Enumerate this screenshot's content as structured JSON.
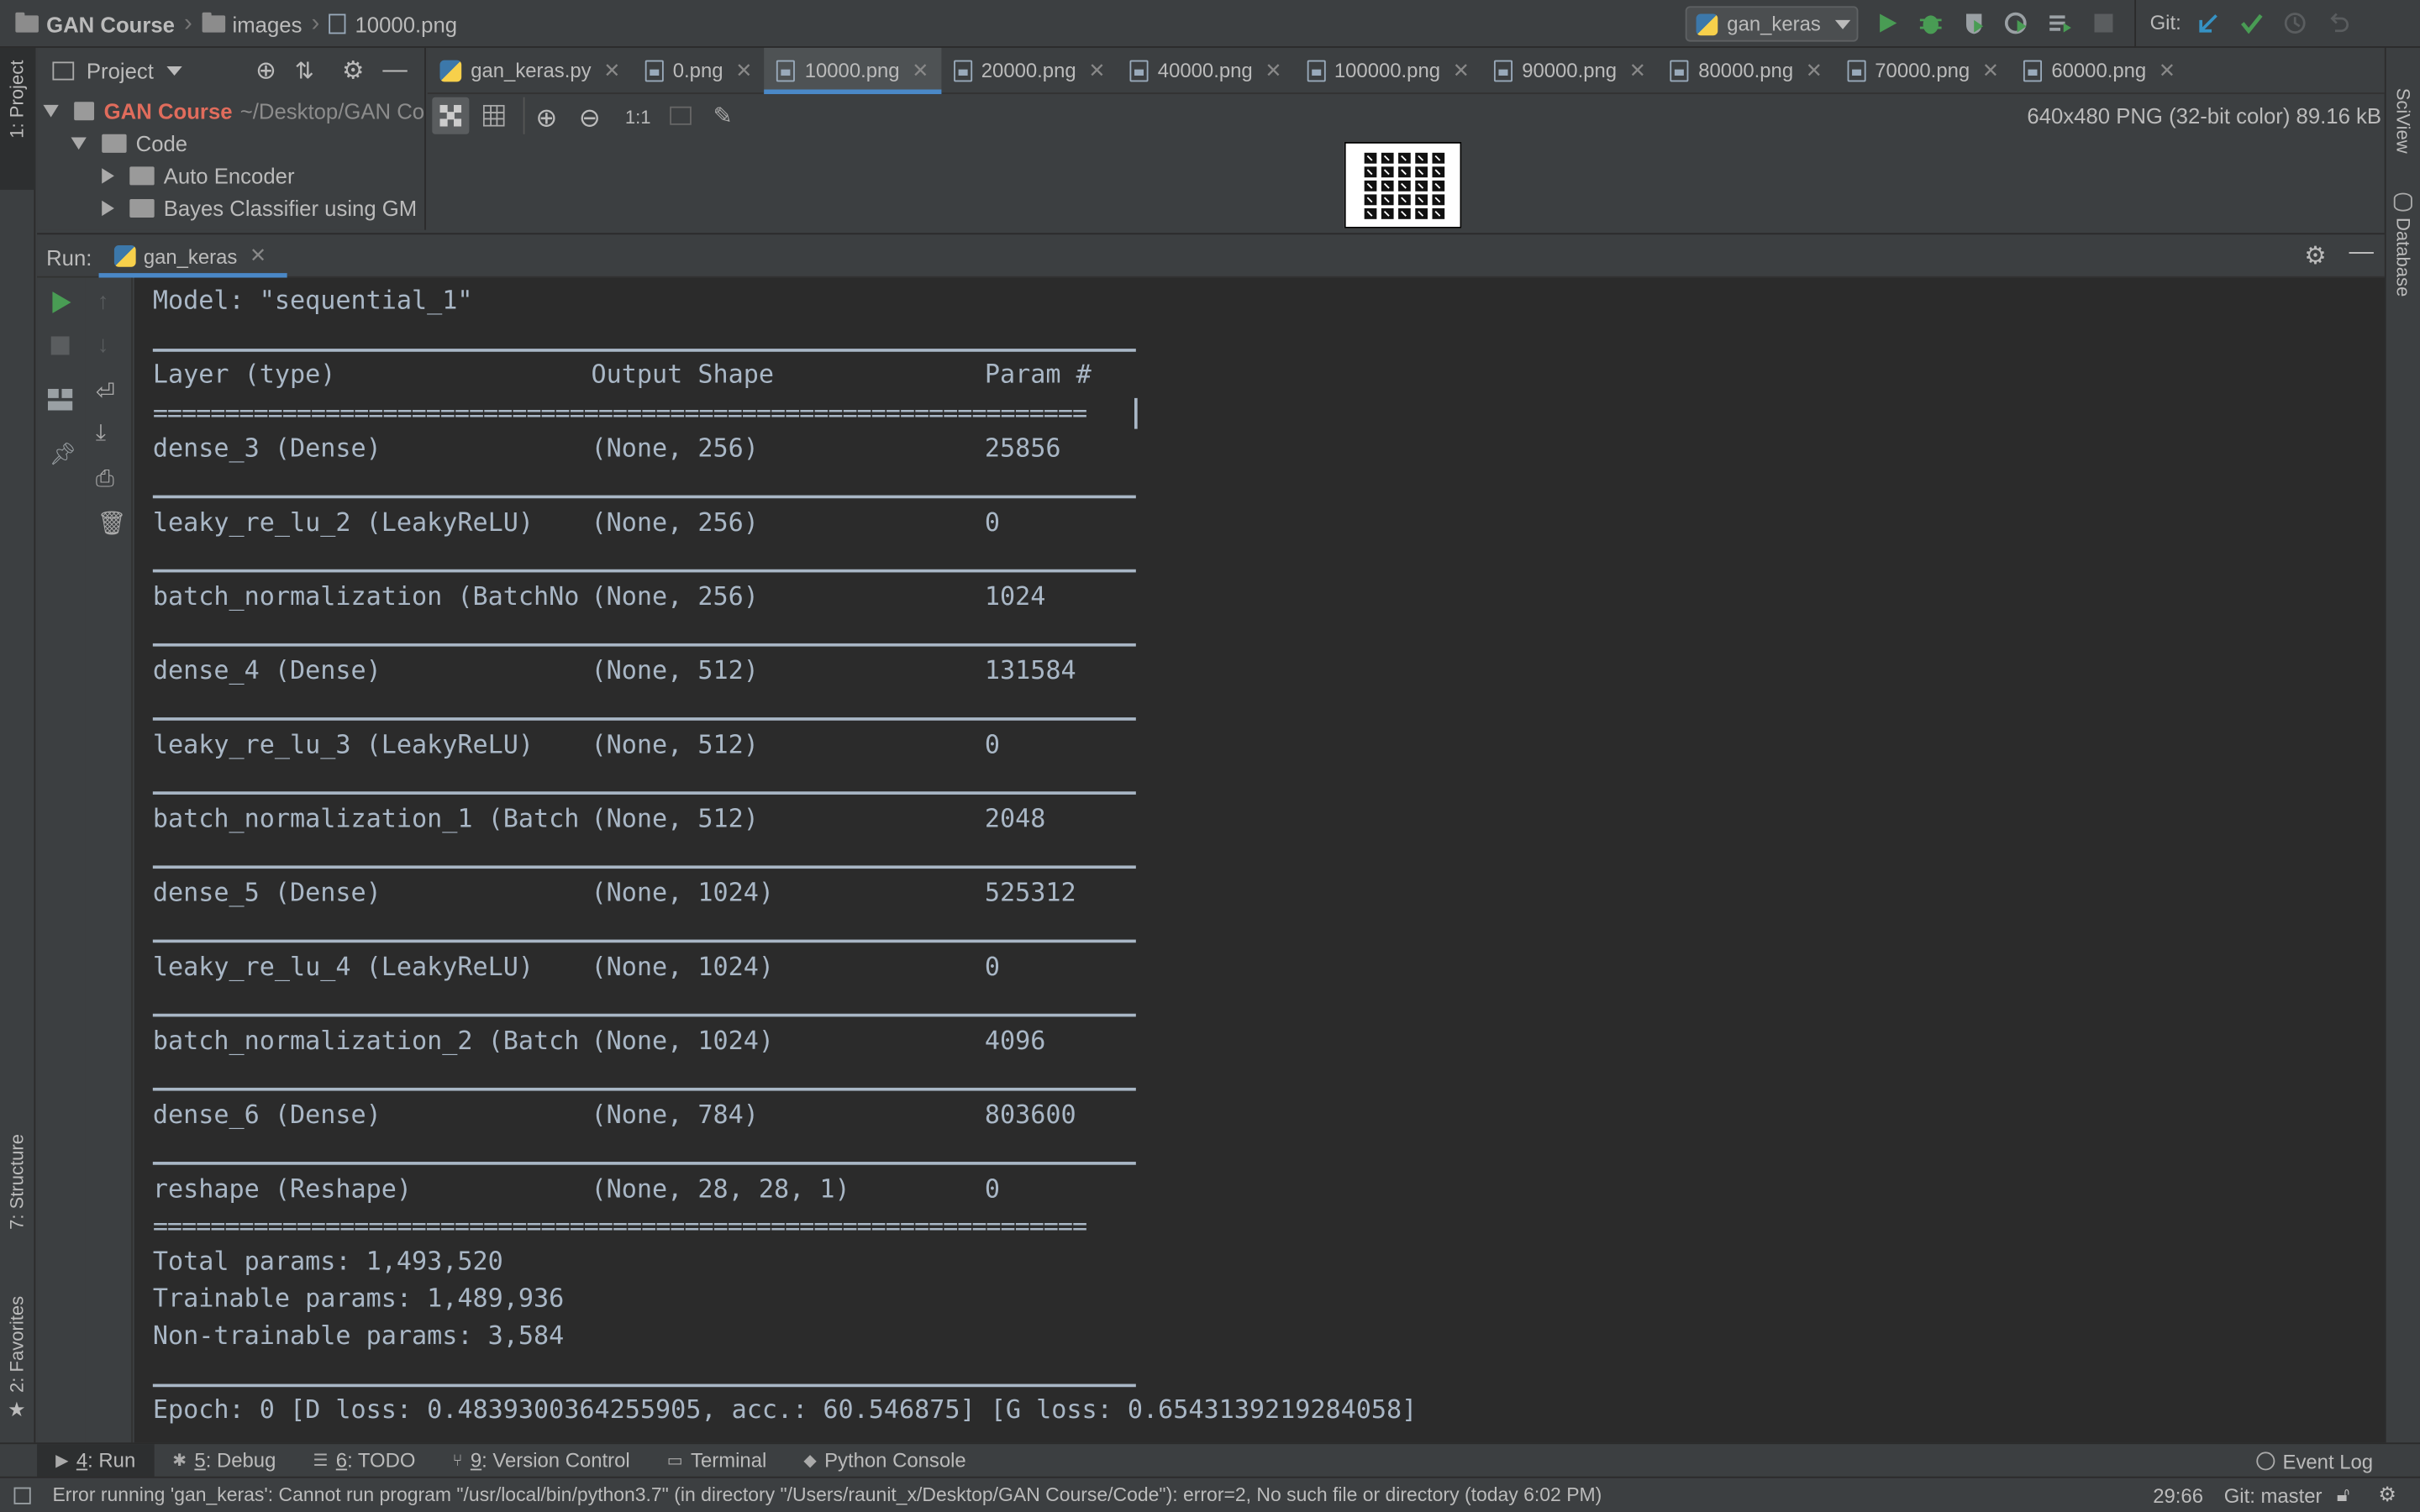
{
  "breadcrumb": {
    "project": "GAN Course",
    "folder": "images",
    "file": "10000.png"
  },
  "toolbar": {
    "run_config": "gan_keras",
    "git_label": "Git:"
  },
  "project_panel": {
    "title": "Project",
    "tree": [
      {
        "label": "GAN Course",
        "suffix": "~/Desktop/GAN Co",
        "expanded": true
      },
      {
        "label": "Code",
        "expanded": true
      },
      {
        "label": "Auto Encoder",
        "expanded": false
      },
      {
        "label": "Bayes Classifier using GM",
        "expanded": false
      }
    ]
  },
  "tabs": [
    {
      "label": "gan_keras.py",
      "active": false
    },
    {
      "label": "0.png",
      "active": false
    },
    {
      "label": "10000.png",
      "active": true
    },
    {
      "label": "20000.png",
      "active": false
    },
    {
      "label": "40000.png",
      "active": false
    },
    {
      "label": "100000.png",
      "active": false
    },
    {
      "label": "90000.png",
      "active": false
    },
    {
      "label": "80000.png",
      "active": false
    },
    {
      "label": "70000.png",
      "active": false
    },
    {
      "label": "60000.png",
      "active": false
    }
  ],
  "image_viewer": {
    "zoom_label": "1:1",
    "info": "640x480 PNG (32-bit color) 89.16 kB"
  },
  "run_panel": {
    "label": "Run:",
    "tab": "gan_keras"
  },
  "console": {
    "model_line": "Model: \"sequential_1\"",
    "headers": {
      "layer": "Layer (type)",
      "shape": "Output Shape",
      "params": "Param #"
    },
    "double_rule": "=================================================================",
    "layers": [
      {
        "layer": "dense_3 (Dense)",
        "shape": "(None, 256)",
        "params": "25856"
      },
      {
        "layer": "leaky_re_lu_2 (LeakyReLU)",
        "shape": "(None, 256)",
        "params": "0"
      },
      {
        "layer": "batch_normalization (BatchNo",
        "shape": "(None, 256)",
        "params": "1024"
      },
      {
        "layer": "dense_4 (Dense)",
        "shape": "(None, 512)",
        "params": "131584"
      },
      {
        "layer": "leaky_re_lu_3 (LeakyReLU)",
        "shape": "(None, 512)",
        "params": "0"
      },
      {
        "layer": "batch_normalization_1 (Batch",
        "shape": "(None, 512)",
        "params": "2048"
      },
      {
        "layer": "dense_5 (Dense)",
        "shape": "(None, 1024)",
        "params": "525312"
      },
      {
        "layer": "leaky_re_lu_4 (LeakyReLU)",
        "shape": "(None, 1024)",
        "params": "0"
      },
      {
        "layer": "batch_normalization_2 (Batch",
        "shape": "(None, 1024)",
        "params": "4096"
      },
      {
        "layer": "dense_6 (Dense)",
        "shape": "(None, 784)",
        "params": "803600"
      },
      {
        "layer": "reshape (Reshape)",
        "shape": "(None, 28, 28, 1)",
        "params": "0"
      }
    ],
    "total": "Total params: 1,493,520",
    "trainable": "Trainable params: 1,489,936",
    "non_trainable": "Non-trainable params: 3,584",
    "epoch_line": "Epoch: 0 [D loss: 0.4839300364255905, acc.: 60.546875] [G loss: 0.6543139219284058]"
  },
  "side_tools": {
    "project": "1: Project",
    "structure": "7: Structure",
    "favorites": "2: Favorites",
    "sciview": "SciView",
    "database": "Database"
  },
  "bottom_tools": [
    {
      "key": "4",
      "label": ": Run",
      "active": true
    },
    {
      "key": "5",
      "label": ": Debug",
      "active": false
    },
    {
      "key": "6",
      "label": ": TODO",
      "active": false
    },
    {
      "key": "9",
      "label": ": Version Control",
      "active": false
    },
    {
      "key": "",
      "label": "Terminal",
      "active": false
    },
    {
      "key": "",
      "label": "Python Console",
      "active": false
    }
  ],
  "event_log": "Event Log",
  "status": {
    "message": "Error running 'gan_keras': Cannot run program \"/usr/local/bin/python3.7\" (in directory \"/Users/raunit_x/Desktop/GAN Course/Code\"): error=2, No such file or directory (today 6:02 PM)",
    "position": "29:66",
    "branch": "Git: master"
  },
  "colors": {
    "accent": "#4a88c7",
    "run_green": "#499c54",
    "project_red": "#e06c5c",
    "bg": "#3c3f41",
    "console_bg": "#2b2b2b"
  }
}
